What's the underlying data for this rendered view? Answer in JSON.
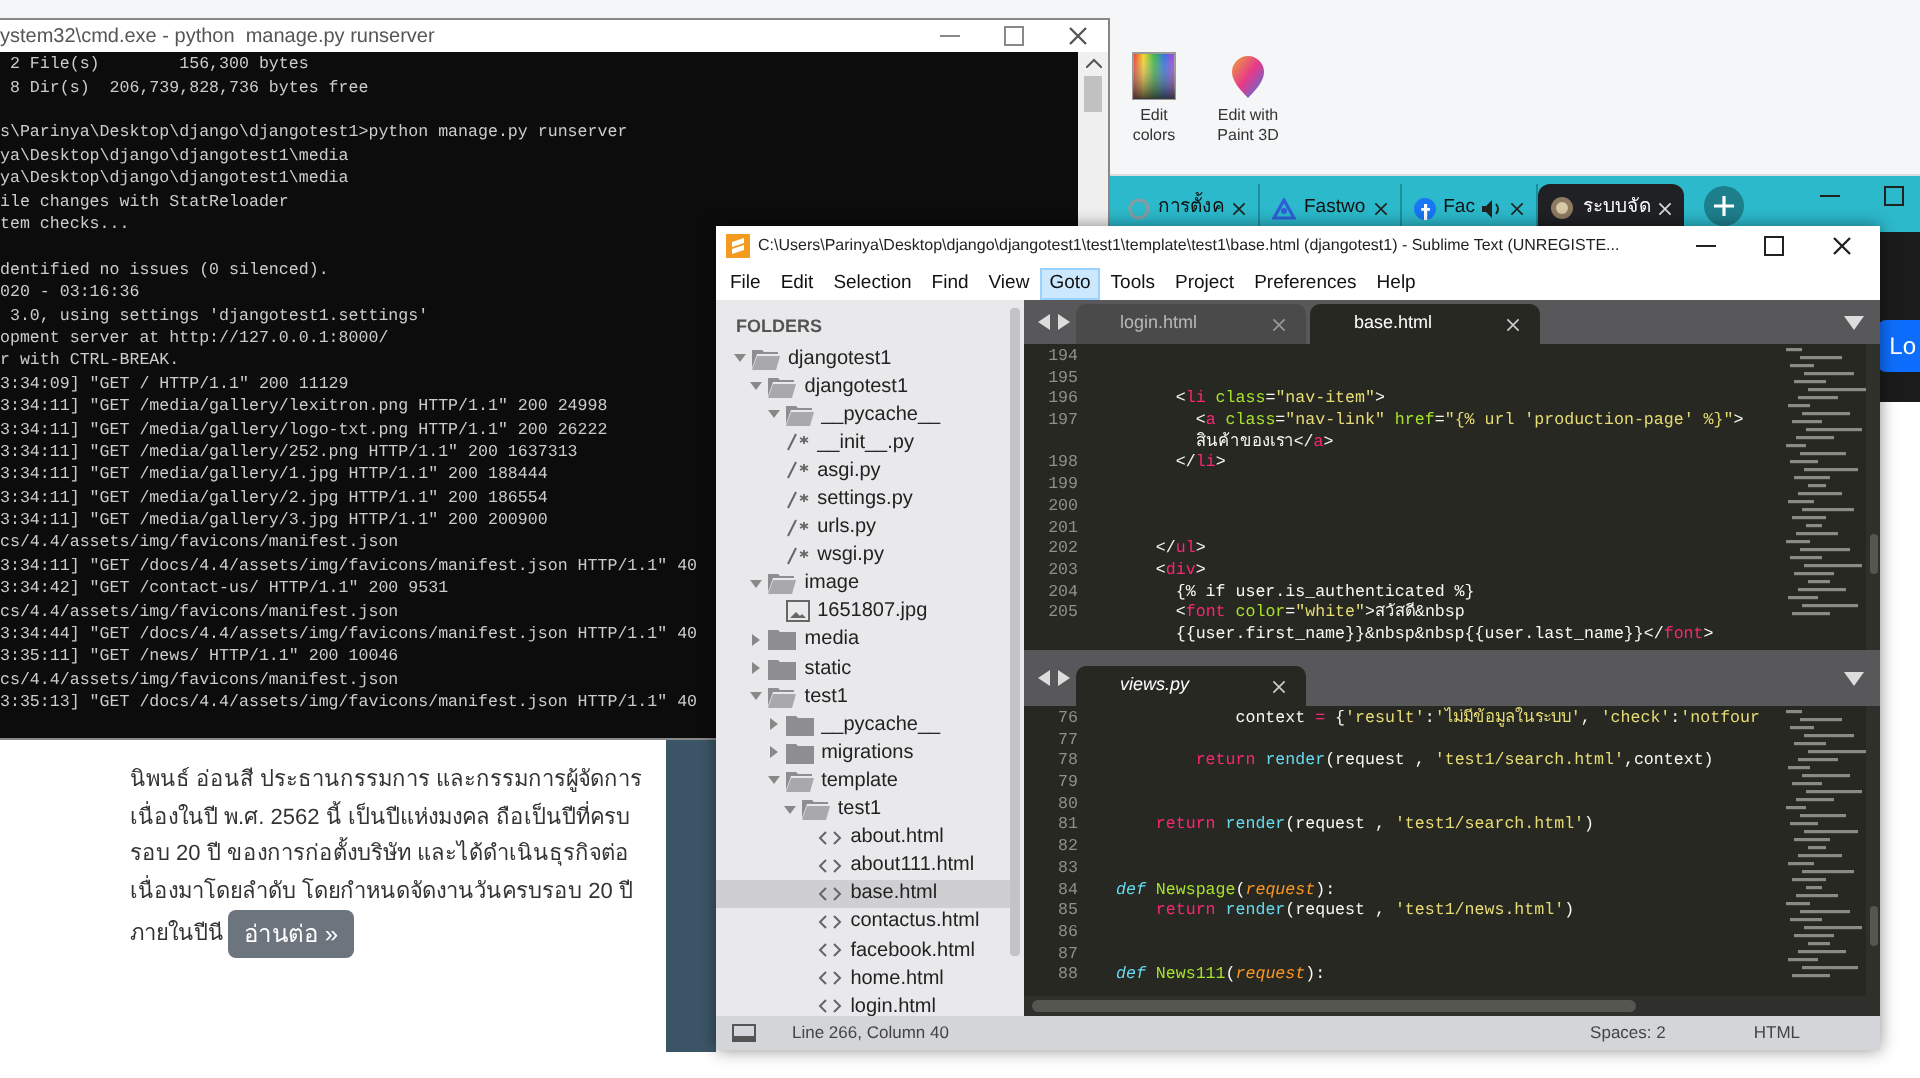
{
  "paint": {
    "ribbon": [
      {
        "label": "Edit colors",
        "kind": "palette"
      },
      {
        "label": "Edit with Paint 3D",
        "kind": "paint3d"
      }
    ]
  },
  "browser": {
    "tabs": [
      {
        "label": "การตั้งค",
        "kind": "spinner",
        "selected": false,
        "audio": false
      },
      {
        "label": "Fastwo",
        "kind": "triangle",
        "selected": false,
        "audio": false
      },
      {
        "label": "Fac",
        "kind": "circle",
        "selected": false,
        "audio": true
      },
      {
        "label": "ระบบจัด",
        "kind": "emblem",
        "selected": true,
        "audio": false
      }
    ],
    "login_button": "Lo",
    "article": {
      "lines": [
        "นิพนธ์ อ่อนสี ประธานกรรมการ และกรรมการผู้จัดการ",
        "เนื่องในปี พ.ศ. 2562 นี้ เป็นปีแห่งมงคล ถือเป็นปีที่ครบ",
        "รอบ 20 ปี ของการก่อตั้งบริษัท และได้ดำเนินธุรกิจต่อ",
        "เนื่องมาโดยลำดับ โดยกำหนดจัดงานวันครบรอบ 20 ปี",
        "ภายในปีนี"
      ],
      "button": "อ่านต่อ »"
    }
  },
  "cmd": {
    "title": "ystem32\\cmd.exe - python  manage.py runserver",
    "blocks": [
      [
        " 2 File(s)        156,300 bytes",
        " 8 Dir(s)  206,739,828,736 bytes free"
      ],
      [
        "s\\Parinya\\Desktop\\django\\djangotest1>python manage.py runserver",
        "ya\\Desktop\\django\\djangotest1\\media",
        "ya\\Desktop\\django\\djangotest1\\media",
        "ile changes with StatReloader",
        "tem checks..."
      ],
      [
        "dentified no issues (0 silenced).",
        "020 - 03:16:36",
        " 3.0, using settings 'djangotest1.settings'",
        "opment server at http://127.0.0.1:8000/",
        "r with CTRL-BREAK.",
        "3:34:09] \"GET / HTTP/1.1\" 200 11129",
        "3:34:11] \"GET /media/gallery/lexitron.png HTTP/1.1\" 200 24998",
        "3:34:11] \"GET /media/gallery/logo-txt.png HTTP/1.1\" 200 26222",
        "3:34:11] \"GET /media/gallery/252.png HTTP/1.1\" 200 1637313",
        "3:34:11] \"GET /media/gallery/1.jpg HTTP/1.1\" 200 188444",
        "3:34:11] \"GET /media/gallery/2.jpg HTTP/1.1\" 200 186554",
        "3:34:11] \"GET /media/gallery/3.jpg HTTP/1.1\" 200 200900",
        "cs/4.4/assets/img/favicons/manifest.json",
        "3:34:11] \"GET /docs/4.4/assets/img/favicons/manifest.json HTTP/1.1\" 40",
        "3:34:42] \"GET /contact-us/ HTTP/1.1\" 200 9531",
        "cs/4.4/assets/img/favicons/manifest.json",
        "3:34:44] \"GET /docs/4.4/assets/img/favicons/manifest.json HTTP/1.1\" 40",
        "3:35:11] \"GET /news/ HTTP/1.1\" 200 10046",
        "cs/4.4/assets/img/favicons/manifest.json",
        "3:35:13] \"GET /docs/4.4/assets/img/favicons/manifest.json HTTP/1.1\" 40"
      ]
    ]
  },
  "sublime": {
    "title": "C:\\Users\\Parinya\\Desktop\\django\\djangotest1\\test1\\template\\test1\\base.html (djangotest1) - Sublime Text (UNREGISTE...",
    "menu": [
      {
        "label": "File",
        "selected": false
      },
      {
        "label": "Edit",
        "selected": false
      },
      {
        "label": "Selection",
        "selected": false
      },
      {
        "label": "Find",
        "selected": false
      },
      {
        "label": "View",
        "selected": false
      },
      {
        "label": "Goto",
        "selected": true
      },
      {
        "label": "Tools",
        "selected": false
      },
      {
        "label": "Project",
        "selected": false
      },
      {
        "label": "Preferences",
        "selected": false
      },
      {
        "label": "Help",
        "selected": false
      }
    ],
    "sidebar": {
      "heading": "FOLDERS",
      "tree": [
        {
          "label": "djangotest1",
          "kind": "folder",
          "expanded": true,
          "selected": false,
          "children": [
            {
              "label": "djangotest1",
              "kind": "folder",
              "expanded": true,
              "selected": false,
              "children": [
                {
                  "label": "__pycache__",
                  "kind": "folder",
                  "expanded": true,
                  "selected": false
                },
                {
                  "label": "__init__.py",
                  "kind": "python",
                  "selected": false
                },
                {
                  "label": "asgi.py",
                  "kind": "python",
                  "selected": false
                },
                {
                  "label": "settings.py",
                  "kind": "python",
                  "selected": false
                },
                {
                  "label": "urls.py",
                  "kind": "python",
                  "selected": false
                },
                {
                  "label": "wsgi.py",
                  "kind": "python",
                  "selected": false
                }
              ]
            },
            {
              "label": "image",
              "kind": "folder",
              "expanded": true,
              "selected": false,
              "children": [
                {
                  "label": "1651807.jpg",
                  "kind": "image",
                  "selected": false
                }
              ]
            },
            {
              "label": "media",
              "kind": "folder",
              "expanded": false,
              "selected": false
            },
            {
              "label": "static",
              "kind": "folder",
              "expanded": false,
              "selected": false
            },
            {
              "label": "test1",
              "kind": "folder",
              "expanded": true,
              "selected": false,
              "children": [
                {
                  "label": "__pycache__",
                  "kind": "folder",
                  "expanded": false,
                  "selected": false
                },
                {
                  "label": "migrations",
                  "kind": "folder",
                  "expanded": false,
                  "selected": false
                },
                {
                  "label": "template",
                  "kind": "folder",
                  "expanded": true,
                  "selected": false,
                  "children": [
                    {
                      "label": "test1",
                      "kind": "folder",
                      "expanded": true,
                      "selected": false,
                      "children": [
                        {
                          "label": "about.html",
                          "kind": "html",
                          "selected": false
                        },
                        {
                          "label": "about111.html",
                          "kind": "html",
                          "selected": false
                        },
                        {
                          "label": "base.html",
                          "kind": "html",
                          "selected": true
                        },
                        {
                          "label": "contactus.html",
                          "kind": "html",
                          "selected": false
                        },
                        {
                          "label": "facebook.html",
                          "kind": "html",
                          "selected": false
                        },
                        {
                          "label": "home.html",
                          "kind": "html",
                          "selected": false
                        },
                        {
                          "label": "login.html",
                          "kind": "html",
                          "selected": false
                        }
                      ]
                    }
                  ]
                }
              ]
            }
          ]
        }
      ]
    },
    "panes": [
      {
        "tabs": [
          {
            "label": "login.html",
            "selected": false,
            "preview": false
          },
          {
            "label": "base.html",
            "selected": true,
            "preview": false
          }
        ],
        "lines": [
          {
            "number": "194"
          },
          {
            "number": "195"
          },
          {
            "number": "196",
            "tokens": [
              {
                "text": "      <",
                "kind": "plain"
              },
              {
                "text": "li",
                "kind": "tag"
              },
              {
                "text": " class",
                "kind": "attr"
              },
              {
                "text": "=",
                "kind": "plain"
              },
              {
                "text": "\"nav-item\"",
                "kind": "string"
              },
              {
                "text": ">",
                "kind": "plain"
              }
            ]
          },
          {
            "number": "197",
            "tokens": [
              {
                "text": "        <",
                "kind": "plain"
              },
              {
                "text": "a",
                "kind": "tag"
              },
              {
                "text": " class",
                "kind": "attr"
              },
              {
                "text": "=",
                "kind": "plain"
              },
              {
                "text": "\"nav-link\"",
                "kind": "string"
              },
              {
                "text": " href",
                "kind": "attr"
              },
              {
                "text": "=",
                "kind": "plain"
              },
              {
                "text": "\"{% url 'production-page' %}\"",
                "kind": "string"
              },
              {
                "text": ">",
                "kind": "plain"
              }
            ]
          },
          {
            "tokens": [
              {
                "text": "        สินค้าของเรา</",
                "kind": "plain"
              },
              {
                "text": "a",
                "kind": "tag"
              },
              {
                "text": ">",
                "kind": "plain"
              }
            ]
          },
          {
            "number": "198",
            "tokens": [
              {
                "text": "      </",
                "kind": "plain"
              },
              {
                "text": "li",
                "kind": "tag"
              },
              {
                "text": ">",
                "kind": "plain"
              }
            ]
          },
          {
            "number": "199"
          },
          {
            "number": "200"
          },
          {
            "number": "201"
          },
          {
            "number": "202",
            "tokens": [
              {
                "text": "    </",
                "kind": "plain"
              },
              {
                "text": "ul",
                "kind": "tag"
              },
              {
                "text": ">",
                "kind": "plain"
              }
            ]
          },
          {
            "number": "203",
            "tokens": [
              {
                "text": "    <",
                "kind": "plain"
              },
              {
                "text": "div",
                "kind": "tag"
              },
              {
                "text": ">",
                "kind": "plain"
              }
            ]
          },
          {
            "number": "204",
            "tokens": [
              {
                "text": "      {% if user.is_authenticated %}",
                "kind": "plain"
              }
            ]
          },
          {
            "number": "205",
            "tokens": [
              {
                "text": "      <",
                "kind": "plain"
              },
              {
                "text": "font",
                "kind": "tag"
              },
              {
                "text": " color",
                "kind": "attr"
              },
              {
                "text": "=",
                "kind": "plain"
              },
              {
                "text": "\"white\"",
                "kind": "string"
              },
              {
                "text": ">สวัสดี&nbsp",
                "kind": "plain"
              }
            ]
          },
          {
            "tokens": [
              {
                "text": "      {{user.first_name}}&nbsp&nbsp{{user.last_name}}</",
                "kind": "plain"
              },
              {
                "text": "font",
                "kind": "tag"
              },
              {
                "text": ">",
                "kind": "plain"
              }
            ]
          }
        ]
      },
      {
        "tabs": [
          {
            "label": "views.py",
            "selected": true,
            "preview": true
          }
        ],
        "lines": [
          {
            "number": "76",
            "tokens": [
              {
                "text": "            context ",
                "kind": "plain"
              },
              {
                "text": "=",
                "kind": "operator"
              },
              {
                "text": " {",
                "kind": "plain"
              },
              {
                "text": "'result'",
                "kind": "string"
              },
              {
                "text": ":",
                "kind": "plain"
              },
              {
                "text": "'ไม่มีข้อมูลในระบบ'",
                "kind": "string"
              },
              {
                "text": ", ",
                "kind": "plain"
              },
              {
                "text": "'check'",
                "kind": "string"
              },
              {
                "text": ":",
                "kind": "plain"
              },
              {
                "text": "'notfour",
                "kind": "string"
              }
            ]
          },
          {
            "number": "77"
          },
          {
            "number": "78",
            "tokens": [
              {
                "text": "        return",
                "kind": "keyword"
              },
              {
                "text": " render",
                "kind": "builtin"
              },
              {
                "text": "(request , ",
                "kind": "plain"
              },
              {
                "text": "'test1/search.html'",
                "kind": "string"
              },
              {
                "text": ",context)",
                "kind": "plain"
              }
            ]
          },
          {
            "number": "79"
          },
          {
            "number": "80"
          },
          {
            "number": "81",
            "tokens": [
              {
                "text": "    return",
                "kind": "keyword"
              },
              {
                "text": " render",
                "kind": "builtin"
              },
              {
                "text": "(request , ",
                "kind": "plain"
              },
              {
                "text": "'test1/search.html'",
                "kind": "string"
              },
              {
                "text": ")",
                "kind": "plain"
              }
            ]
          },
          {
            "number": "82"
          },
          {
            "number": "83"
          },
          {
            "number": "84",
            "tokens": [
              {
                "text": "def",
                "kind": "storage"
              },
              {
                "text": " Newspage",
                "kind": "func"
              },
              {
                "text": "(",
                "kind": "plain"
              },
              {
                "text": "request",
                "kind": "param"
              },
              {
                "text": "):",
                "kind": "plain"
              }
            ]
          },
          {
            "number": "85",
            "tokens": [
              {
                "text": "    return",
                "kind": "keyword"
              },
              {
                "text": " render",
                "kind": "builtin"
              },
              {
                "text": "(request , ",
                "kind": "plain"
              },
              {
                "text": "'test1/news.html'",
                "kind": "string"
              },
              {
                "text": ")",
                "kind": "plain"
              }
            ]
          },
          {
            "number": "86"
          },
          {
            "number": "87"
          },
          {
            "number": "88",
            "tokens": [
              {
                "text": "def",
                "kind": "storage"
              },
              {
                "text": " News111",
                "kind": "func"
              },
              {
                "text": "(",
                "kind": "plain"
              },
              {
                "text": "request",
                "kind": "param"
              },
              {
                "text": "):",
                "kind": "plain"
              }
            ]
          }
        ]
      }
    ],
    "status": {
      "position": "Line 266, Column 40",
      "indent": "Spaces: 2",
      "syntax": "HTML"
    }
  }
}
